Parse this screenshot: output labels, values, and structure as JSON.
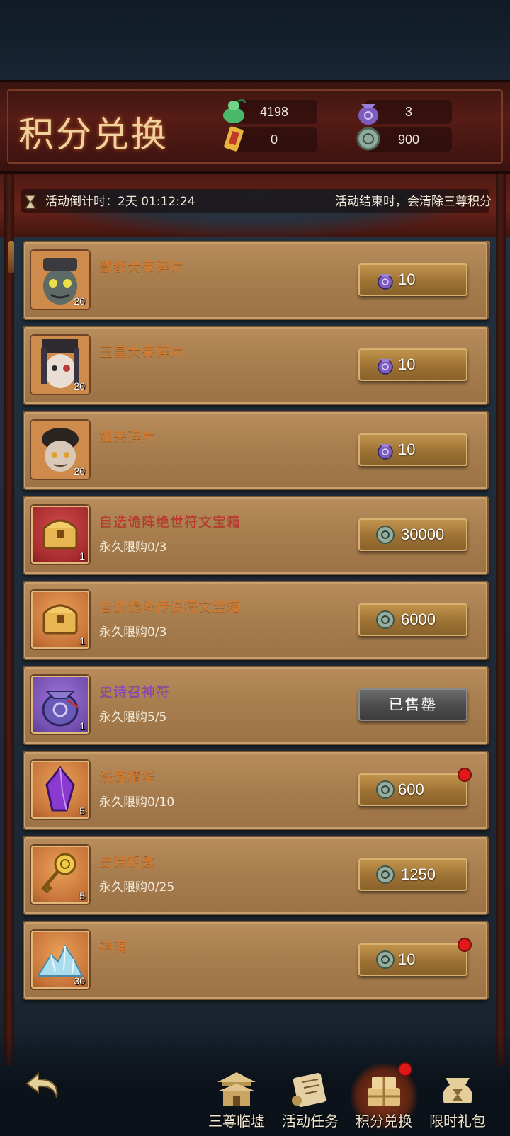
{
  "header": {
    "title": "积分兑换",
    "currencies": [
      {
        "icon": "jade-gourd-icon",
        "value": "4198"
      },
      {
        "icon": "purple-pouch-icon",
        "value": "3"
      },
      {
        "icon": "talisman-scroll-icon",
        "value": "0"
      },
      {
        "icon": "jade-coin-icon",
        "value": "900"
      }
    ]
  },
  "event": {
    "countdown": "活动倒计时：2天 01:12:24",
    "notice": "活动结束时，会清除三尊积分"
  },
  "items": [
    {
      "name": "酆都大帝碎片",
      "limit": "",
      "qty": "20",
      "price": "10",
      "cost_icon": "purple-pouch-icon",
      "frame": "portrait",
      "item_icon": "fengdu-emperor-portrait-icon",
      "name_color": "orange",
      "sold": false,
      "red_dot": false
    },
    {
      "name": "玉皇大帝碎片",
      "limit": "",
      "qty": "20",
      "price": "10",
      "cost_icon": "purple-pouch-icon",
      "frame": "portrait",
      "item_icon": "jade-emperor-portrait-icon",
      "name_color": "orange",
      "sold": false,
      "red_dot": false
    },
    {
      "name": "如来碎片",
      "limit": "",
      "qty": "20",
      "price": "10",
      "cost_icon": "purple-pouch-icon",
      "frame": "portrait",
      "item_icon": "tathagata-portrait-icon",
      "name_color": "orange",
      "sold": false,
      "red_dot": false
    },
    {
      "name": "自选诡阵绝世符文宝箱",
      "limit": "永久限购0/3",
      "qty": "1",
      "price": "30000",
      "cost_icon": "jade-coin-icon",
      "frame": "red",
      "item_icon": "treasure-chest-icon",
      "name_color": "red",
      "sold": false,
      "red_dot": false
    },
    {
      "name": "自选诡阵传说符文宝箱",
      "limit": "永久限购0/3",
      "qty": "1",
      "price": "6000",
      "cost_icon": "jade-coin-icon",
      "frame": "orange",
      "item_icon": "treasure-chest-icon",
      "name_color": "orange",
      "sold": false,
      "red_dot": false
    },
    {
      "name": "史诗召神符",
      "limit": "永久限购5/5",
      "qty": "1",
      "price": "",
      "sold_label": "已售罄",
      "cost_icon": "",
      "frame": "purple",
      "item_icon": "purple-pouch-icon",
      "name_color": "purple",
      "sold": true,
      "red_dot": false
    },
    {
      "name": "洗炼精华",
      "limit": "永久限购0/10",
      "qty": "5",
      "price": "600",
      "cost_icon": "jade-coin-icon",
      "frame": "orange",
      "item_icon": "purple-crystal-icon",
      "name_color": "orange",
      "sold": false,
      "red_dot": true
    },
    {
      "name": "史诗钥匙",
      "limit": "永久限购0/25",
      "qty": "5",
      "price": "1250",
      "cost_icon": "jade-coin-icon",
      "frame": "orange",
      "item_icon": "golden-key-icon",
      "name_color": "orange",
      "sold": false,
      "red_dot": false
    },
    {
      "name": "神魂",
      "limit": "",
      "qty": "30",
      "price": "10",
      "cost_icon": "jade-coin-icon",
      "frame": "orange",
      "item_icon": "soul-crystal-pile-icon",
      "name_color": "orange",
      "sold": false,
      "red_dot": true
    }
  ],
  "nav": {
    "tabs": [
      {
        "label": "三尊临墟",
        "icon": "temple-icon",
        "active": false,
        "red_dot": false
      },
      {
        "label": "活动任务",
        "icon": "scroll-icon",
        "active": false,
        "red_dot": false
      },
      {
        "label": "积分兑换",
        "icon": "gift-pile-icon",
        "active": true,
        "red_dot": true
      },
      {
        "label": "限时礼包",
        "icon": "hourglass-bag-icon",
        "active": false,
        "red_dot": false
      }
    ]
  },
  "colors": {
    "name_orange": "#d9792a",
    "name_red": "#c43430",
    "name_purple": "#8c44c2",
    "red_dot": "#e01818"
  }
}
